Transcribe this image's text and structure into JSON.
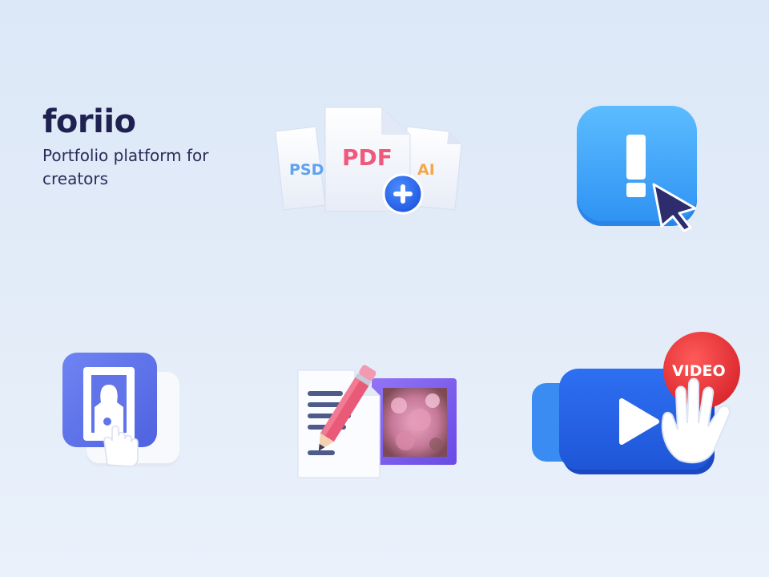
{
  "brand": {
    "name": "foriio",
    "tagline": "Portfolio platform for creators"
  },
  "illustrations": {
    "file_upload": {
      "icon": "file-upload-icon",
      "labels": {
        "left": "PSD",
        "center": "PDF",
        "right": "AI"
      }
    },
    "alert": {
      "icon": "alert-cursor-icon"
    },
    "portrait_select": {
      "icon": "portrait-select-icon"
    },
    "edit_document": {
      "icon": "edit-document-icon"
    },
    "video": {
      "icon": "video-play-icon",
      "badge": "VIDEO"
    }
  },
  "colors": {
    "brand_text": "#1f2150",
    "accent_blue": "#2f6ff0",
    "alert_blue": "#3fa8f8",
    "pdf_pink": "#ef5a7c",
    "psd_blue": "#5ea3ef",
    "ai_orange": "#f3a84b",
    "video_red": "#e8363b",
    "frame_purple": "#7d5cf0"
  }
}
